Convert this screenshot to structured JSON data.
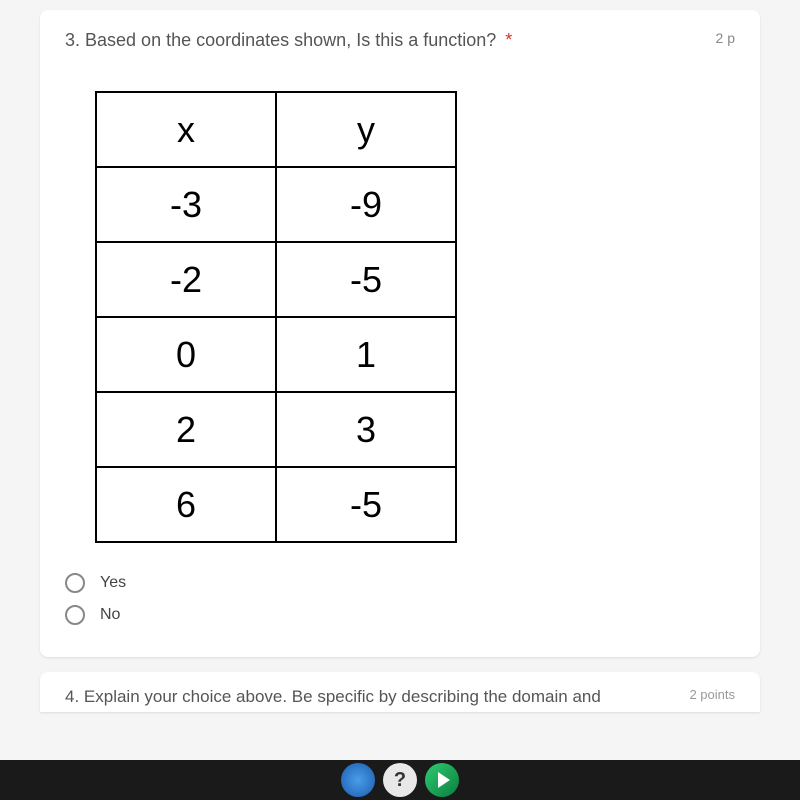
{
  "question3": {
    "number_and_text": "3. Based on the coordinates shown, Is this a function?",
    "required_marker": "*",
    "points": "2 p",
    "table": {
      "headers": {
        "x": "x",
        "y": "y"
      },
      "rows": [
        {
          "x": "-3",
          "y": "-9"
        },
        {
          "x": "-2",
          "y": "-5"
        },
        {
          "x": "0",
          "y": "1"
        },
        {
          "x": "2",
          "y": "3"
        },
        {
          "x": "6",
          "y": "-5"
        }
      ]
    },
    "options": {
      "yes": "Yes",
      "no": "No"
    }
  },
  "question4": {
    "text": "4. Explain your choice above. Be specific by describing the domain and",
    "points": "2 points"
  },
  "taskbar": {
    "question_icon": "?"
  }
}
